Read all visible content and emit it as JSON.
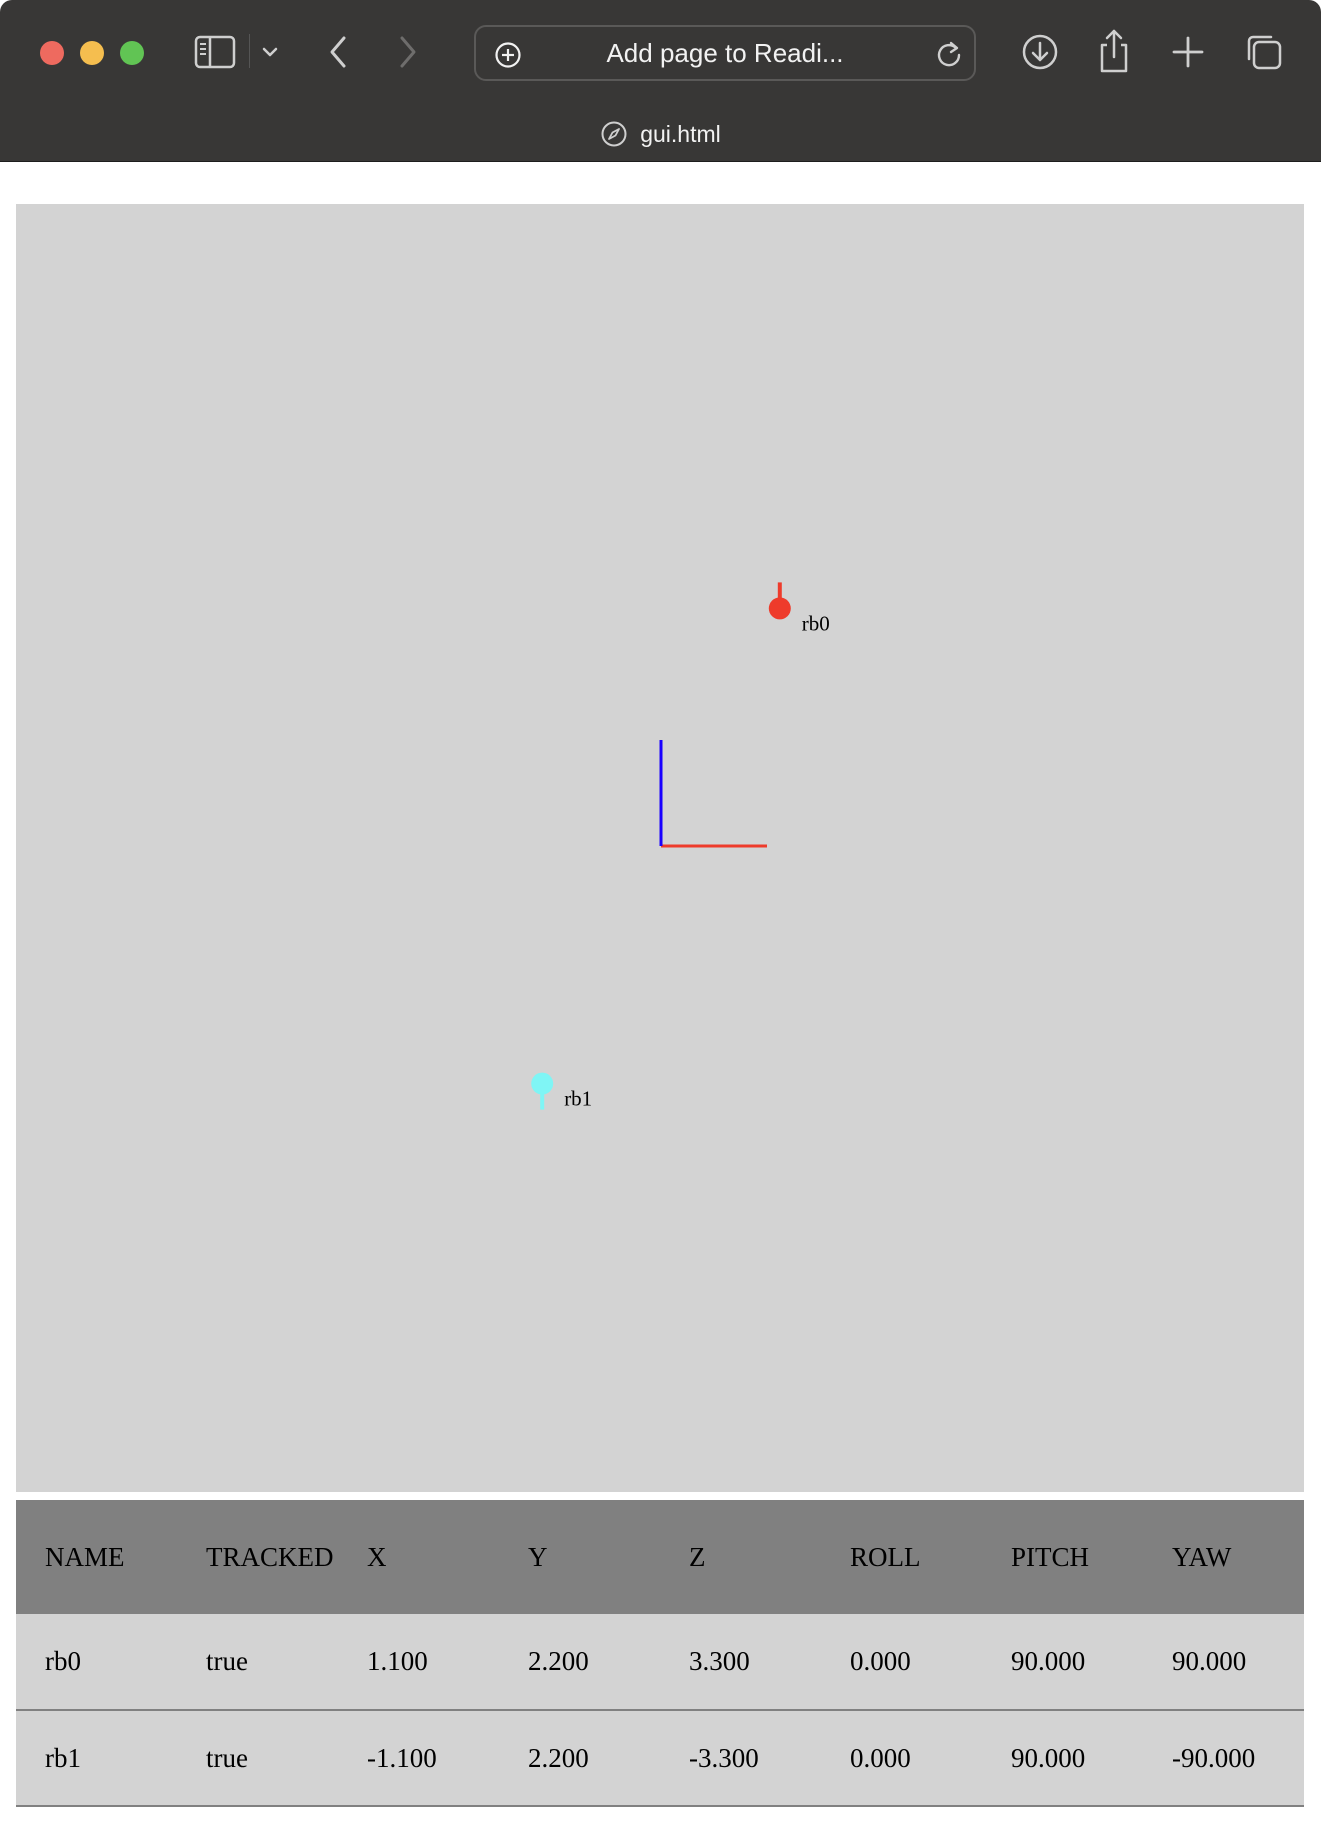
{
  "browser": {
    "address_text": "Add page to Readi...",
    "tab_title": "gui.html"
  },
  "icons": [
    "close-window-icon",
    "minimize-window-icon",
    "zoom-window-icon",
    "sidebar-icon",
    "chevron-down-icon",
    "back-arrow-icon",
    "forward-arrow-icon",
    "add-circle-icon",
    "reload-icon",
    "download-icon",
    "share-icon",
    "new-tab-plus-icon",
    "tab-overview-icon",
    "compass-icon"
  ],
  "colors": {
    "chrome_bg": "#383736",
    "viewer_bg": "#d3d3d3",
    "table_header_bg": "#808080",
    "axis_x": "#ee3b2b",
    "axis_y": "#1a00ff",
    "rb0_color": "#ee3b2b",
    "rb1_color": "#7ff5f5"
  },
  "viewer": {
    "bodies": [
      {
        "name": "rb0",
        "x": 1.1,
        "y": 2.2,
        "color": "#ee3b2b",
        "stem": "up"
      },
      {
        "name": "rb1",
        "x": -1.1,
        "y": -2.2,
        "color": "#7ff5f5",
        "stem": "down"
      }
    ]
  },
  "table": {
    "headers": [
      "NAME",
      "TRACKED",
      "X",
      "Y",
      "Z",
      "ROLL",
      "PITCH",
      "YAW"
    ],
    "rows": [
      [
        "rb0",
        "true",
        "1.100",
        "2.200",
        "3.300",
        "0.000",
        "90.000",
        "90.000"
      ],
      [
        "rb1",
        "true",
        "-1.100",
        "2.200",
        "-3.300",
        "0.000",
        "90.000",
        "-90.000"
      ]
    ]
  }
}
